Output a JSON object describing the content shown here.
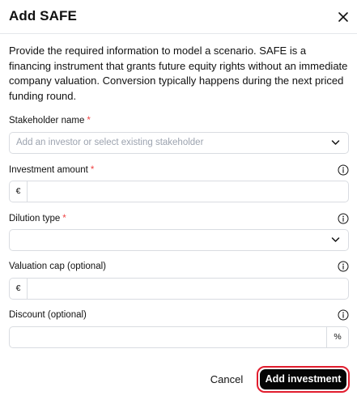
{
  "dialog": {
    "title": "Add SAFE",
    "intro": "Provide the required information to model a scenario. SAFE is a financing instrument that grants future equity rights without an immediate company valuation. Conversion typically happens during the next priced funding round."
  },
  "fields": {
    "stakeholder": {
      "label": "Stakeholder name",
      "required_mark": "*",
      "placeholder": "Add an investor or select existing stakeholder",
      "icon": "chevron-down-icon"
    },
    "investment_amount": {
      "label": "Investment amount",
      "required_mark": "*",
      "prefix": "€",
      "value": "",
      "icon": "info-icon"
    },
    "dilution_type": {
      "label": "Dilution type",
      "required_mark": "*",
      "selected": "",
      "icon": "info-icon"
    },
    "valuation_cap": {
      "label": "Valuation cap (optional)",
      "prefix": "€",
      "value": "",
      "icon": "info-icon"
    },
    "discount": {
      "label": "Discount (optional)",
      "suffix": "%",
      "value": "",
      "icon": "info-icon"
    }
  },
  "footer": {
    "cancel_label": "Cancel",
    "submit_label": "Add investment"
  },
  "colors": {
    "required": "#ef4444",
    "primary_button": "#050505",
    "focus_ring": "#e11d2e",
    "border": "#d9dce1",
    "placeholder": "#9ca3af"
  }
}
